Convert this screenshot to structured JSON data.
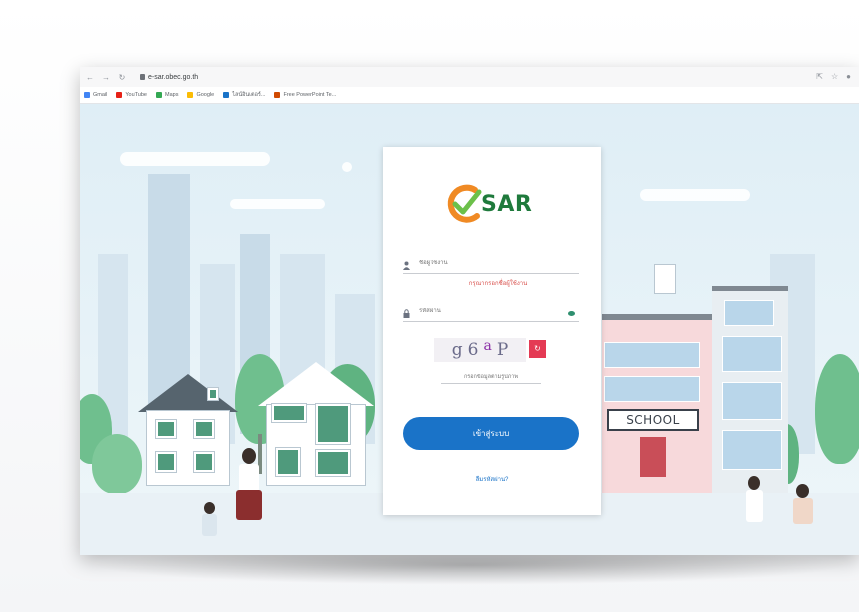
{
  "browser": {
    "nav_icons": [
      "back-icon",
      "forward-icon",
      "reload-icon"
    ],
    "url": "e-sar.obec.go.th",
    "right_icons": [
      "share-icon",
      "star-icon",
      "profile-icon"
    ],
    "bookmarks": [
      {
        "label": "Gmail",
        "color": "#4285f4"
      },
      {
        "label": "YouTube",
        "color": "#e62117"
      },
      {
        "label": "Maps",
        "color": "#34a853"
      },
      {
        "label": "Google",
        "color": "#fbbc05"
      },
      {
        "label": "ไลน์อินเตอร์...",
        "color": "#1a73c8"
      },
      {
        "label": "Free PowerPoint Te...",
        "color": "#d04a02"
      }
    ]
  },
  "login": {
    "logo_text": "SAR",
    "username_placeholder": "ชื่อผู้ใช้งาน",
    "username_error": "กรุณากรอกชื่อผู้ใช้งาน",
    "password_placeholder": "รหัสผ่าน",
    "captcha_chars": [
      "g",
      "6",
      "a",
      "P"
    ],
    "captcha_placeholder": "กรอกข้อมูลตามรูปภาพ",
    "submit_label": "เข้าสู่ระบบ",
    "forgot_label": "ลืมรหัสผ่าน?"
  },
  "scene": {
    "school_sign": "SCHOOL"
  },
  "colors": {
    "accent": "#1a73c8",
    "logo_green": "#1f7a3c",
    "logo_orange": "#f08a24",
    "error": "#d9534f"
  }
}
